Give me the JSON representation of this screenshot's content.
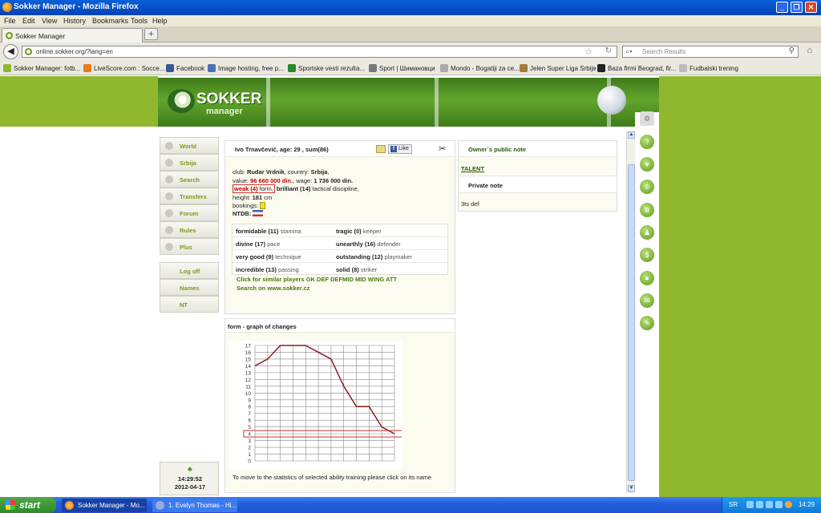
{
  "window": {
    "title": "Sokker Manager - Mozilla Firefox"
  },
  "menu": [
    "File",
    "Edit",
    "View",
    "History",
    "Bookmarks",
    "Tools",
    "Help"
  ],
  "tab": {
    "label": "Sokker Manager"
  },
  "url": "online.sokker.org/?lang=en",
  "search": {
    "placeholder": "Search Results"
  },
  "bookmarks": [
    "Sokker Manager: fotb...",
    "LiveScore.com : Socce...",
    "Facebook",
    "Image hosting, free p...",
    "Sportske vesti rezulta...",
    "Sport | Шимановци",
    "Mondo - Bogatiji za ce...",
    "Jelen Super Liga Srbije",
    "Baza firmi Beograd, fir...",
    "Fudbalski trening"
  ],
  "logo": {
    "line1": "SOKKER",
    "line2": "manager"
  },
  "leftmenu": [
    "World",
    "Srbija",
    "Search",
    "Transfers",
    "Forum",
    "Rules",
    "Plus"
  ],
  "leftmenu2": [
    "Log off",
    "Names",
    "NT"
  ],
  "clock": {
    "time": "14:29:52",
    "date": "2012-04-17"
  },
  "player": {
    "name": "Ivo Trnavčević, age: 29 , sum(86)",
    "like": "Like",
    "club_label": "club:",
    "club": "Rudar Vrdnik",
    "country_label": ", country:",
    "country": "Srbija",
    "value_label": "value:",
    "value": "96 660 000 din.",
    "wage_label": ", wage:",
    "wage": "1 736 000 din.",
    "form": "weak (4)",
    "form_label": "form,",
    "tactic": "brilliant (14)",
    "tactic_label": "tactical discipline,",
    "height_label": "height:",
    "height": "181",
    "height_unit": "cm",
    "bookings_label": "bookings:",
    "ntdb_label": "NTDB:",
    "skills": [
      {
        "l": "formidable (11)",
        "n": "stamina",
        "r": "tragic (0)",
        "rn": "keeper"
      },
      {
        "l": "divine (17)",
        "n": "pace",
        "r": "unearthly (16)",
        "rn": "defender"
      },
      {
        "l": "very good (9)",
        "n": "technique",
        "r": "outstanding (12)",
        "rn": "playmaker"
      },
      {
        "l": "incredible (13)",
        "n": "passing",
        "r": "solid (8)",
        "rn": "striker"
      }
    ],
    "similar": "Click for similar players GK DEF DEFMID MID WING ATT",
    "search_link": "Search on www.sokker.cz"
  },
  "note": {
    "title": "Owner`s public note",
    "talent": "TALENT",
    "private": "Private note",
    "text": "3ts def"
  },
  "graph": {
    "title": "form - graph of changes",
    "help": "To move to the statistics of selected ability training please click on its name"
  },
  "chart_data": {
    "type": "line",
    "series": [
      {
        "values": [
          14,
          15,
          17,
          17,
          17,
          16,
          15,
          11,
          8,
          8,
          5,
          4
        ]
      }
    ],
    "ylim": [
      0,
      17
    ],
    "yticks": [
      "0",
      "1",
      "2",
      "3",
      "4",
      "5",
      "6",
      "7",
      "8",
      "9",
      "10",
      "11",
      "12",
      "13",
      "14",
      "15",
      "16",
      "17"
    ],
    "highlight_value": 4,
    "grid": true
  },
  "taskbar": {
    "start": "start",
    "tasks": [
      "Sokker Manager - Mo...",
      "1. Evelyn Thomas - Hi..."
    ],
    "lang": "SR",
    "time": "14:29"
  }
}
